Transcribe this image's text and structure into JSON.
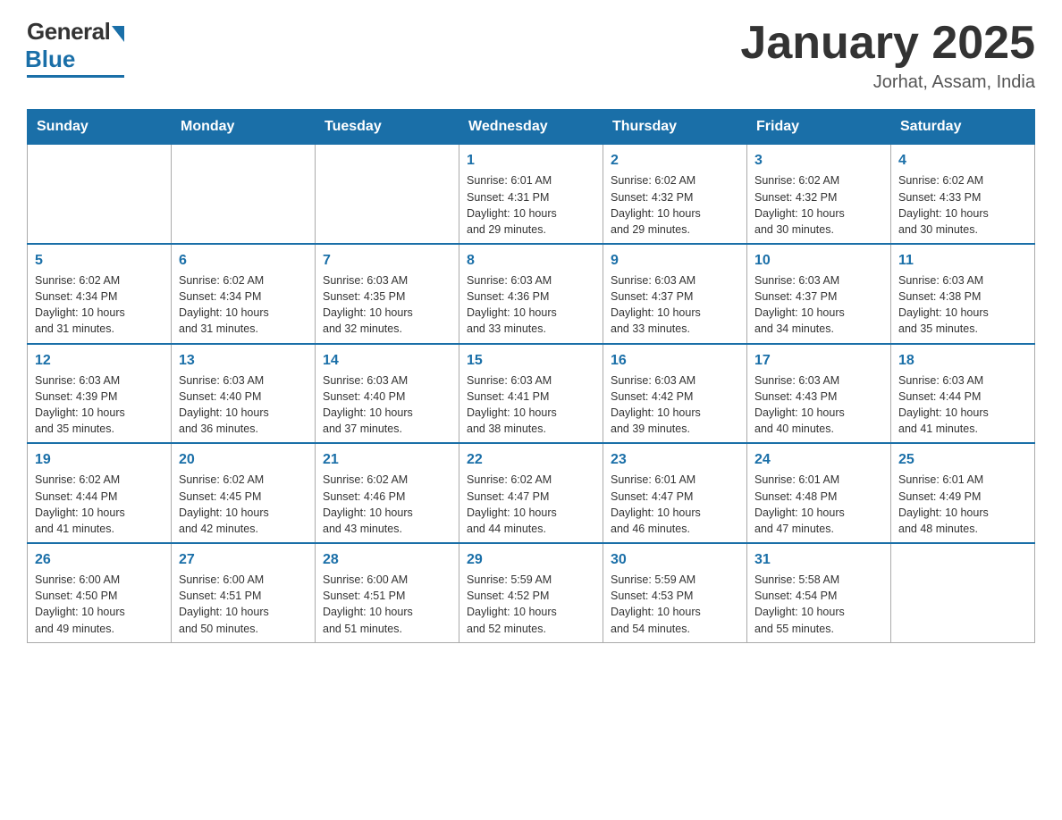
{
  "header": {
    "logo": {
      "general": "General",
      "blue": "Blue"
    },
    "title": "January 2025",
    "location": "Jorhat, Assam, India"
  },
  "days_of_week": [
    "Sunday",
    "Monday",
    "Tuesday",
    "Wednesday",
    "Thursday",
    "Friday",
    "Saturday"
  ],
  "weeks": [
    [
      {
        "day": "",
        "info": ""
      },
      {
        "day": "",
        "info": ""
      },
      {
        "day": "",
        "info": ""
      },
      {
        "day": "1",
        "info": "Sunrise: 6:01 AM\nSunset: 4:31 PM\nDaylight: 10 hours\nand 29 minutes."
      },
      {
        "day": "2",
        "info": "Sunrise: 6:02 AM\nSunset: 4:32 PM\nDaylight: 10 hours\nand 29 minutes."
      },
      {
        "day": "3",
        "info": "Sunrise: 6:02 AM\nSunset: 4:32 PM\nDaylight: 10 hours\nand 30 minutes."
      },
      {
        "day": "4",
        "info": "Sunrise: 6:02 AM\nSunset: 4:33 PM\nDaylight: 10 hours\nand 30 minutes."
      }
    ],
    [
      {
        "day": "5",
        "info": "Sunrise: 6:02 AM\nSunset: 4:34 PM\nDaylight: 10 hours\nand 31 minutes."
      },
      {
        "day": "6",
        "info": "Sunrise: 6:02 AM\nSunset: 4:34 PM\nDaylight: 10 hours\nand 31 minutes."
      },
      {
        "day": "7",
        "info": "Sunrise: 6:03 AM\nSunset: 4:35 PM\nDaylight: 10 hours\nand 32 minutes."
      },
      {
        "day": "8",
        "info": "Sunrise: 6:03 AM\nSunset: 4:36 PM\nDaylight: 10 hours\nand 33 minutes."
      },
      {
        "day": "9",
        "info": "Sunrise: 6:03 AM\nSunset: 4:37 PM\nDaylight: 10 hours\nand 33 minutes."
      },
      {
        "day": "10",
        "info": "Sunrise: 6:03 AM\nSunset: 4:37 PM\nDaylight: 10 hours\nand 34 minutes."
      },
      {
        "day": "11",
        "info": "Sunrise: 6:03 AM\nSunset: 4:38 PM\nDaylight: 10 hours\nand 35 minutes."
      }
    ],
    [
      {
        "day": "12",
        "info": "Sunrise: 6:03 AM\nSunset: 4:39 PM\nDaylight: 10 hours\nand 35 minutes."
      },
      {
        "day": "13",
        "info": "Sunrise: 6:03 AM\nSunset: 4:40 PM\nDaylight: 10 hours\nand 36 minutes."
      },
      {
        "day": "14",
        "info": "Sunrise: 6:03 AM\nSunset: 4:40 PM\nDaylight: 10 hours\nand 37 minutes."
      },
      {
        "day": "15",
        "info": "Sunrise: 6:03 AM\nSunset: 4:41 PM\nDaylight: 10 hours\nand 38 minutes."
      },
      {
        "day": "16",
        "info": "Sunrise: 6:03 AM\nSunset: 4:42 PM\nDaylight: 10 hours\nand 39 minutes."
      },
      {
        "day": "17",
        "info": "Sunrise: 6:03 AM\nSunset: 4:43 PM\nDaylight: 10 hours\nand 40 minutes."
      },
      {
        "day": "18",
        "info": "Sunrise: 6:03 AM\nSunset: 4:44 PM\nDaylight: 10 hours\nand 41 minutes."
      }
    ],
    [
      {
        "day": "19",
        "info": "Sunrise: 6:02 AM\nSunset: 4:44 PM\nDaylight: 10 hours\nand 41 minutes."
      },
      {
        "day": "20",
        "info": "Sunrise: 6:02 AM\nSunset: 4:45 PM\nDaylight: 10 hours\nand 42 minutes."
      },
      {
        "day": "21",
        "info": "Sunrise: 6:02 AM\nSunset: 4:46 PM\nDaylight: 10 hours\nand 43 minutes."
      },
      {
        "day": "22",
        "info": "Sunrise: 6:02 AM\nSunset: 4:47 PM\nDaylight: 10 hours\nand 44 minutes."
      },
      {
        "day": "23",
        "info": "Sunrise: 6:01 AM\nSunset: 4:47 PM\nDaylight: 10 hours\nand 46 minutes."
      },
      {
        "day": "24",
        "info": "Sunrise: 6:01 AM\nSunset: 4:48 PM\nDaylight: 10 hours\nand 47 minutes."
      },
      {
        "day": "25",
        "info": "Sunrise: 6:01 AM\nSunset: 4:49 PM\nDaylight: 10 hours\nand 48 minutes."
      }
    ],
    [
      {
        "day": "26",
        "info": "Sunrise: 6:00 AM\nSunset: 4:50 PM\nDaylight: 10 hours\nand 49 minutes."
      },
      {
        "day": "27",
        "info": "Sunrise: 6:00 AM\nSunset: 4:51 PM\nDaylight: 10 hours\nand 50 minutes."
      },
      {
        "day": "28",
        "info": "Sunrise: 6:00 AM\nSunset: 4:51 PM\nDaylight: 10 hours\nand 51 minutes."
      },
      {
        "day": "29",
        "info": "Sunrise: 5:59 AM\nSunset: 4:52 PM\nDaylight: 10 hours\nand 52 minutes."
      },
      {
        "day": "30",
        "info": "Sunrise: 5:59 AM\nSunset: 4:53 PM\nDaylight: 10 hours\nand 54 minutes."
      },
      {
        "day": "31",
        "info": "Sunrise: 5:58 AM\nSunset: 4:54 PM\nDaylight: 10 hours\nand 55 minutes."
      },
      {
        "day": "",
        "info": ""
      }
    ]
  ]
}
